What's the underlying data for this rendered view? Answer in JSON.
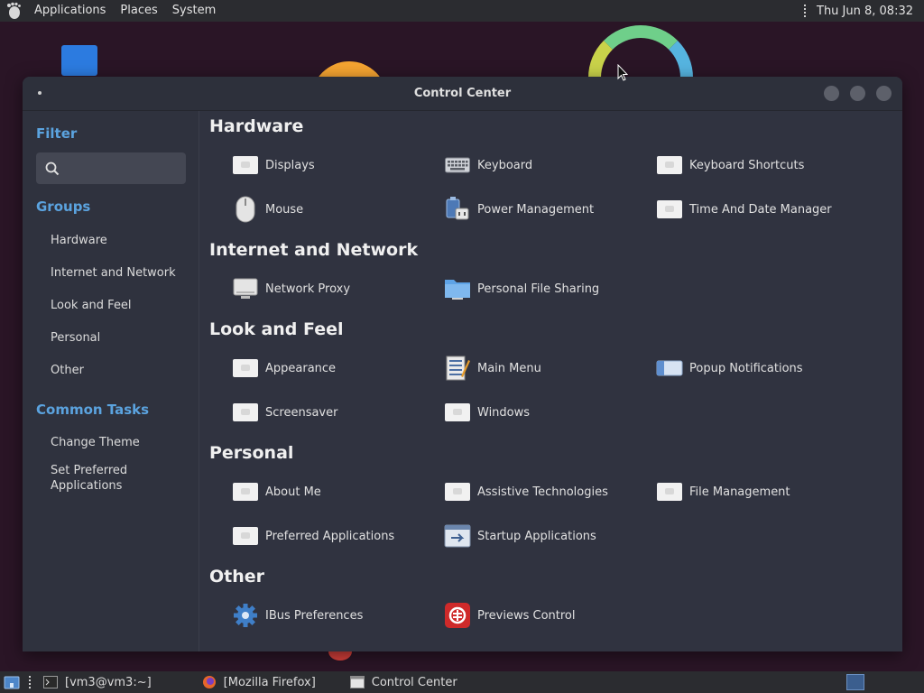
{
  "top_panel": {
    "menus": [
      "Applications",
      "Places",
      "System"
    ],
    "clock": "Thu Jun  8, 08:32"
  },
  "window": {
    "title": "Control Center"
  },
  "sidebar": {
    "filter_heading": "Filter",
    "search_placeholder": "",
    "groups_heading": "Groups",
    "groups": [
      "Hardware",
      "Internet and Network",
      "Look and Feel",
      "Personal",
      "Other"
    ],
    "tasks_heading": "Common Tasks",
    "tasks": [
      "Change Theme",
      "Set Preferred Applications"
    ]
  },
  "sections": [
    {
      "title": "Hardware",
      "items": [
        "Displays",
        "Keyboard",
        "Keyboard Shortcuts",
        "Mouse",
        "Power Management",
        "Time And Date Manager"
      ]
    },
    {
      "title": "Internet and Network",
      "items": [
        "Network Proxy",
        "Personal File Sharing"
      ]
    },
    {
      "title": "Look and Feel",
      "items": [
        "Appearance",
        "Main Menu",
        "Popup Notifications",
        "Screensaver",
        "Windows"
      ]
    },
    {
      "title": "Personal",
      "items": [
        "About Me",
        "Assistive Technologies",
        "File Management",
        "Preferred Applications",
        "Startup Applications"
      ]
    },
    {
      "title": "Other",
      "items": [
        "IBus Preferences",
        "Previews Control"
      ]
    }
  ],
  "taskbar": {
    "tasks": [
      "[vm3@vm3:~]",
      "[Mozilla Firefox]",
      "Control Center"
    ]
  },
  "colors": {
    "accent": "#5ba3df",
    "window_bg": "#303340",
    "panel_bg": "#2b2c30"
  }
}
